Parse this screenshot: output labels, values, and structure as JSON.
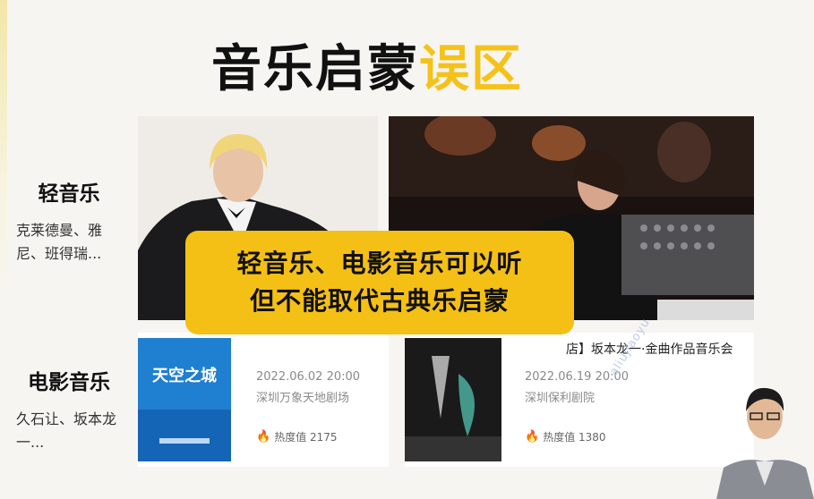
{
  "title": {
    "main": "音乐启蒙",
    "accent": "误区"
  },
  "categories": [
    {
      "title": "轻音乐",
      "desc": "克莱德曼、雅尼、班得瑞..."
    },
    {
      "title": "电影音乐",
      "desc": "久石让、坂本龙一..."
    }
  ],
  "callout": {
    "line1": "轻音乐、电影音乐可以听",
    "line2": "但不能取代古典乐启蒙"
  },
  "tickets": [
    {
      "poster_text": "天空之城",
      "date": "2022.06.02 20:00",
      "venue": "深圳万象天地剧场",
      "heat": "热度值 2175"
    },
    {
      "name": "店】坂本龙一·金曲作品音乐会",
      "date": "2022.06.19 20:00",
      "venue": "深圳保利剧院",
      "heat": "热度值 1380"
    }
  ],
  "watermark": "aliujiaoyu",
  "colors": {
    "accent": "#f4c21a",
    "callout_bg": "#f5c015",
    "heat_icon": "#e8543c"
  },
  "icons": {
    "heat": "flame-icon"
  }
}
